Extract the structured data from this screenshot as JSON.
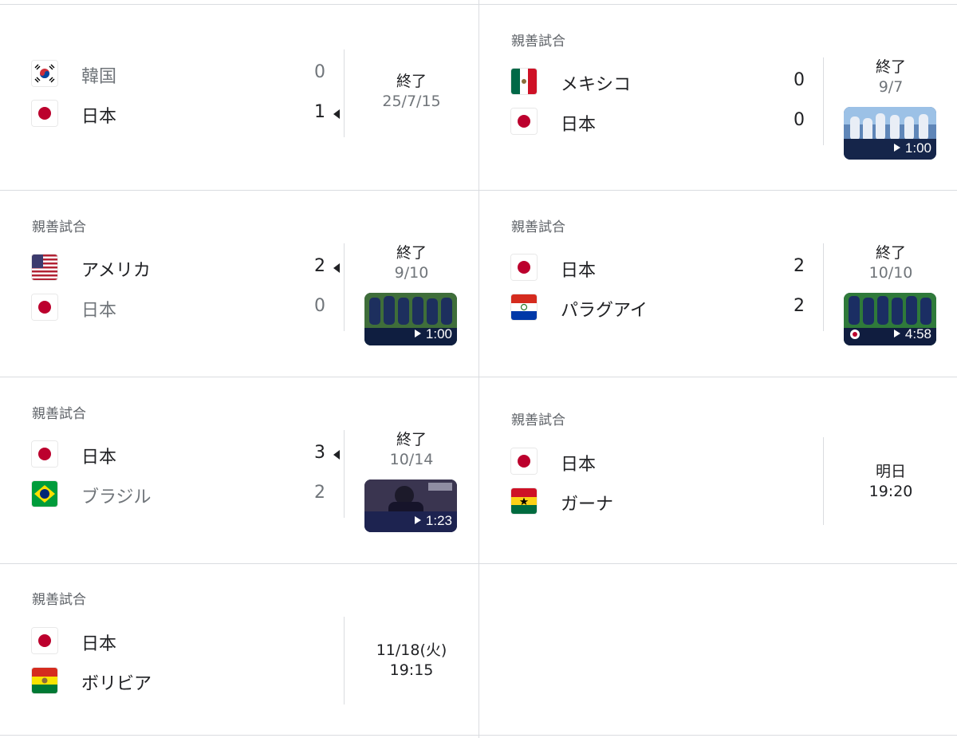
{
  "matches": [
    {
      "label": "",
      "teams": [
        {
          "name": "韓国",
          "flag": "korea-flag-icon",
          "score": "0",
          "winner": false
        },
        {
          "name": "日本",
          "flag": "japan-flag-icon",
          "score": "1",
          "winner": true
        }
      ],
      "status_line1": "終了",
      "status_line2": "25/7/15",
      "video": null
    },
    {
      "label": "親善試合",
      "teams": [
        {
          "name": "メキシコ",
          "flag": "mexico-flag-icon",
          "score": "0",
          "winner": false
        },
        {
          "name": "日本",
          "flag": "japan-flag-icon",
          "score": "0",
          "winner": false
        }
      ],
      "status_line1": "終了",
      "status_line2": "9/7",
      "video": {
        "duration": "1:00"
      }
    },
    {
      "label": "親善試合",
      "teams": [
        {
          "name": "アメリカ",
          "flag": "usa-flag-icon",
          "score": "2",
          "winner": true
        },
        {
          "name": "日本",
          "flag": "japan-flag-icon",
          "score": "0",
          "winner": false
        }
      ],
      "status_line1": "終了",
      "status_line2": "9/10",
      "video": {
        "duration": "1:00"
      }
    },
    {
      "label": "親善試合",
      "teams": [
        {
          "name": "日本",
          "flag": "japan-flag-icon",
          "score": "2",
          "winner": false
        },
        {
          "name": "パラグアイ",
          "flag": "paraguay-flag-icon",
          "score": "2",
          "winner": false
        }
      ],
      "status_line1": "終了",
      "status_line2": "10/10",
      "video": {
        "duration": "4:58"
      }
    },
    {
      "label": "親善試合",
      "teams": [
        {
          "name": "日本",
          "flag": "japan-flag-icon",
          "score": "3",
          "winner": true
        },
        {
          "name": "ブラジル",
          "flag": "brazil-flag-icon",
          "score": "2",
          "winner": false
        }
      ],
      "status_line1": "終了",
      "status_line2": "10/14",
      "video": {
        "duration": "1:23"
      }
    },
    {
      "label": "親善試合",
      "teams": [
        {
          "name": "日本",
          "flag": "japan-flag-icon",
          "score": "",
          "winner": false
        },
        {
          "name": "ガーナ",
          "flag": "ghana-flag-icon",
          "score": "",
          "winner": false
        }
      ],
      "status_line1": "明日",
      "status_line2": "19:20",
      "video": null
    },
    {
      "label": "親善試合",
      "teams": [
        {
          "name": "日本",
          "flag": "japan-flag-icon",
          "score": "",
          "winner": false
        },
        {
          "name": "ボリビア",
          "flag": "bolivia-flag-icon",
          "score": "",
          "winner": false
        }
      ],
      "status_line1": "11/18(火)",
      "status_line2": "19:15",
      "video": null
    }
  ]
}
